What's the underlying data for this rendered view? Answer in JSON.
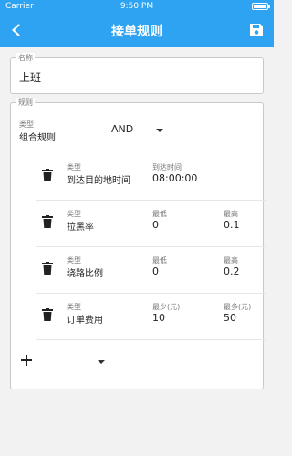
{
  "status": {
    "carrier": "Carrier",
    "time": "9:50 PM"
  },
  "appbar": {
    "title": "接单规则"
  },
  "name_field": {
    "legend": "名称",
    "value": "上班"
  },
  "rules": {
    "legend": "规则",
    "combine": {
      "label_small": "类型",
      "label": "组合规则",
      "value": "AND"
    },
    "items": [
      {
        "type_label": "类型",
        "type_value": "到达目的地时间",
        "c1_label": "到达时间",
        "c1_value": "08:00:00",
        "c2_label": "",
        "c2_value": ""
      },
      {
        "type_label": "类型",
        "type_value": "拉黑率",
        "c1_label": "最低",
        "c1_value": "0",
        "c2_label": "最高",
        "c2_value": "0.1"
      },
      {
        "type_label": "类型",
        "type_value": "绕路比例",
        "c1_label": "最低",
        "c1_value": "0",
        "c2_label": "最高",
        "c2_value": "0.2"
      },
      {
        "type_label": "类型",
        "type_value": "订单费用",
        "c1_label": "最少(元)",
        "c1_value": "10",
        "c2_label": "最多(元)",
        "c2_value": "50"
      }
    ]
  },
  "colors": {
    "primary": "#2ea3f2"
  },
  "icons": {
    "back": "chevron-left-icon",
    "save": "save-icon",
    "delete": "trash-icon",
    "add": "plus-icon",
    "dropdown": "caret-down-icon"
  }
}
